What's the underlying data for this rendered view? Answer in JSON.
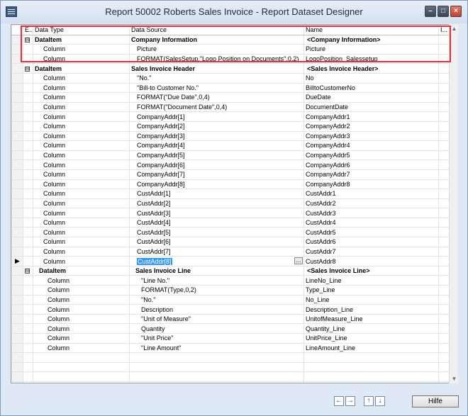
{
  "window": {
    "title": "Report 50002 Roberts Sales Invoice - Report Dataset Designer",
    "controls": {
      "minimize": "–",
      "maximize": "□",
      "close": "×"
    }
  },
  "grid": {
    "headers": {
      "e": "E...",
      "data_type": "Data Type",
      "data_source": "Data Source",
      "name": "Name",
      "i": "I..."
    },
    "rows": [
      {
        "data_type": "DataItem",
        "data_source": "Company Information",
        "name": "<Company Information>"
      },
      {
        "data_type": "Column",
        "data_source": "Picture",
        "name": "Picture"
      },
      {
        "data_type": "Column",
        "data_source": "FORMAT(SalesSetup.\"Logo Position on Documents\",0,2)",
        "name": "LogoPosition_Salessetup"
      },
      {
        "data_type": "DataItem",
        "data_source": "Sales Invoice Header",
        "name": "<Sales Invoice Header>"
      },
      {
        "data_type": "Column",
        "data_source": "\"No.\"",
        "name": "No"
      },
      {
        "data_type": "Column",
        "data_source": "\"Bill-to Customer No.\"",
        "name": "BilltoCustomerNo"
      },
      {
        "data_type": "Column",
        "data_source": "FORMAT(\"Due Date\",0,4)",
        "name": "DueDate"
      },
      {
        "data_type": "Column",
        "data_source": "FORMAT(\"Document Date\",0,4)",
        "name": "DocumentDate"
      },
      {
        "data_type": "Column",
        "data_source": "CompanyAddr[1]",
        "name": "CompanyAddr1"
      },
      {
        "data_type": "Column",
        "data_source": "CompanyAddr[2]",
        "name": "CompanyAddr2"
      },
      {
        "data_type": "Column",
        "data_source": "CompanyAddr[3]",
        "name": "CompanyAddr3"
      },
      {
        "data_type": "Column",
        "data_source": "CompanyAddr[4]",
        "name": "CompanyAddr4"
      },
      {
        "data_type": "Column",
        "data_source": "CompanyAddr[5]",
        "name": "CompanyAddr5"
      },
      {
        "data_type": "Column",
        "data_source": "CompanyAddr[6]",
        "name": "CompanyAddr6"
      },
      {
        "data_type": "Column",
        "data_source": "CompanyAddr[7]",
        "name": "CompanyAddr7"
      },
      {
        "data_type": "Column",
        "data_source": "CompanyAddr[8]",
        "name": "CompanyAddr8"
      },
      {
        "data_type": "Column",
        "data_source": "CustAddr[1]",
        "name": "CustAddr1"
      },
      {
        "data_type": "Column",
        "data_source": "CustAddr[2]",
        "name": "CustAddr2"
      },
      {
        "data_type": "Column",
        "data_source": "CustAddr[3]",
        "name": "CustAddr3"
      },
      {
        "data_type": "Column",
        "data_source": "CustAddr[4]",
        "name": "CustAddr4"
      },
      {
        "data_type": "Column",
        "data_source": "CustAddr[5]",
        "name": "CustAddr5"
      },
      {
        "data_type": "Column",
        "data_source": "CustAddr[6]",
        "name": "CustAddr6"
      },
      {
        "data_type": "Column",
        "data_source": "CustAddr[7]",
        "name": "CustAddr7"
      },
      {
        "data_type": "Column",
        "data_source": "CustAddr[8]",
        "name": "CustAddr8"
      },
      {
        "data_type": "DataItem",
        "data_source": "Sales Invoice Line",
        "name": "<Sales Invoice Line>"
      },
      {
        "data_type": "Column",
        "data_source": "\"Line No.\"",
        "name": "LineNo_Line"
      },
      {
        "data_type": "Column",
        "data_source": "FORMAT(Type,0,2)",
        "name": "Type_Line"
      },
      {
        "data_type": "Column",
        "data_source": "\"No.\"",
        "name": "No_Line"
      },
      {
        "data_type": "Column",
        "data_source": "Description",
        "name": "Description_Line"
      },
      {
        "data_type": "Column",
        "data_source": "\"Unit of Measure\"",
        "name": "UnitofMeasure_Line"
      },
      {
        "data_type": "Column",
        "data_source": "Quantity",
        "name": "Quantity_Line"
      },
      {
        "data_type": "Column",
        "data_source": "\"Unit Price\"",
        "name": "UnitPrice_Line"
      },
      {
        "data_type": "Column",
        "data_source": "\"Line Amount\"",
        "name": "LineAmount_Line"
      }
    ],
    "expand_symbol": "⊟",
    "row_indicator": "▶",
    "assist_button": "...",
    "highlight_color": "#e3303b",
    "selection_color": "#3399ff"
  },
  "footer": {
    "nav_icons": [
      "arrow-left-icon",
      "arrow-right-icon",
      "arrow-up-icon",
      "arrow-down-icon"
    ],
    "nav_glyphs": [
      "←",
      "→",
      "↑",
      "↓"
    ],
    "help_label": "Hilfe"
  },
  "scrollbar": {
    "up": "▲",
    "down": "▼"
  }
}
